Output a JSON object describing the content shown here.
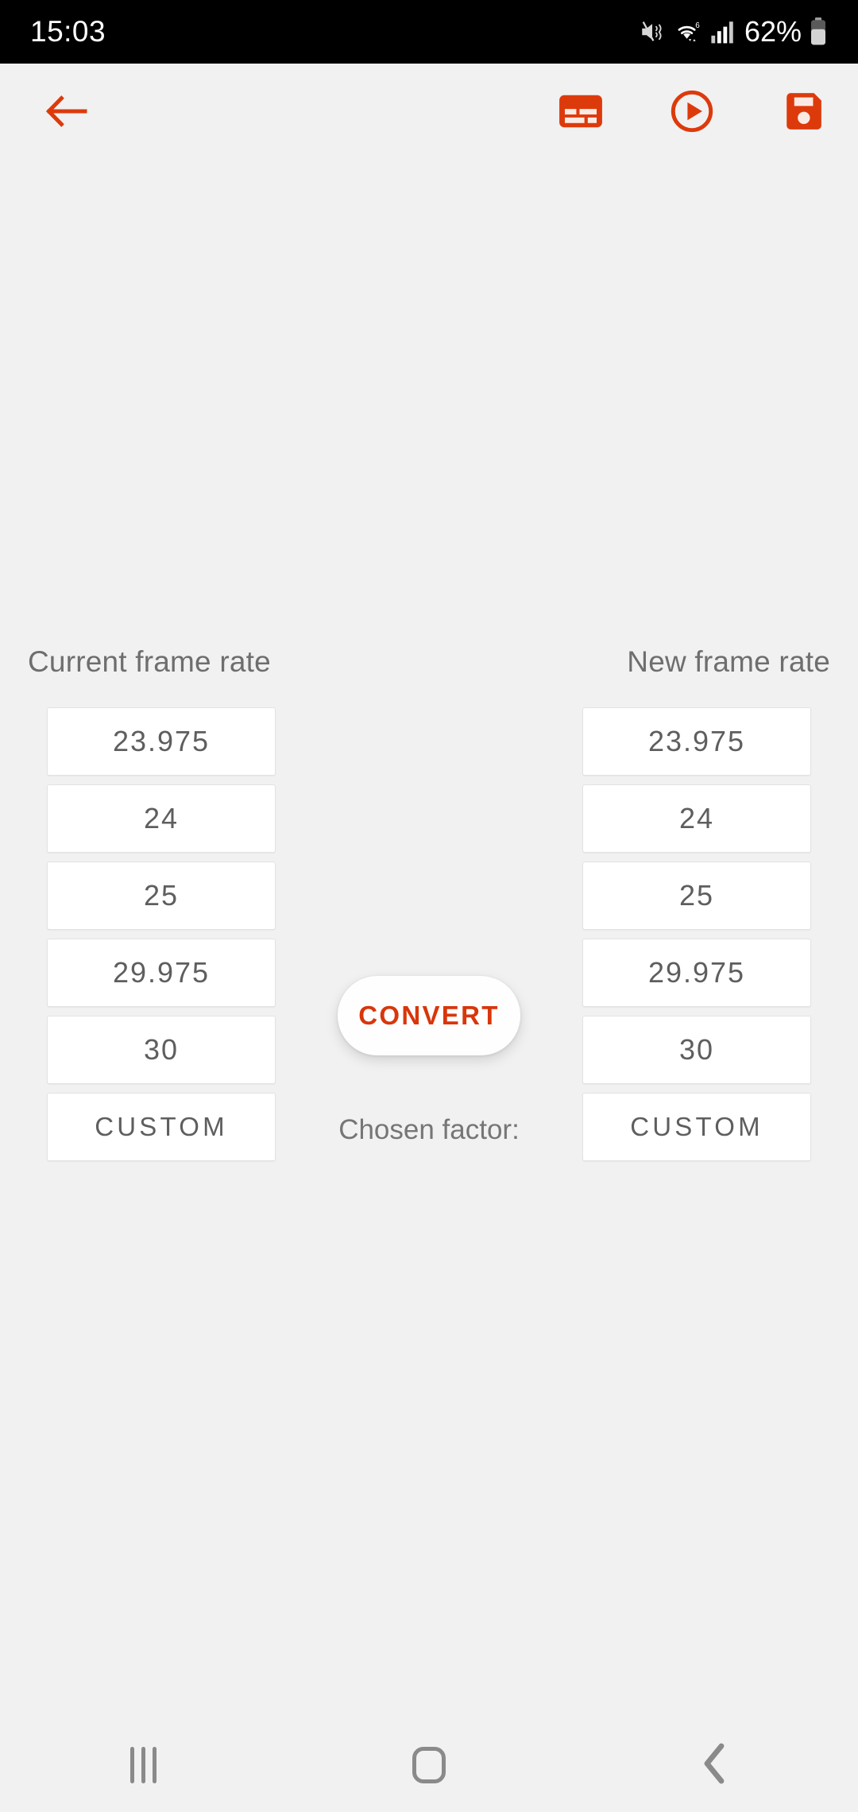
{
  "statusbar": {
    "time": "15:03",
    "battery_percent": "62%",
    "icons": [
      "mute-icon",
      "wifi-icon",
      "signal-icon",
      "battery-icon"
    ]
  },
  "toolbar": {
    "back_label": "back-arrow",
    "actions": [
      {
        "name": "subtitle-button",
        "label": "subtitle-icon"
      },
      {
        "name": "play-button",
        "label": "play-circle-icon"
      },
      {
        "name": "save-button",
        "label": "save-icon"
      }
    ],
    "accent_color": "#dd3a0c"
  },
  "main": {
    "current_header": "Current frame rate",
    "new_header": "New frame rate",
    "current_rates": [
      "23.975",
      "24",
      "25",
      "29.975",
      "30",
      "CUSTOM"
    ],
    "new_rates": [
      "23.975",
      "24",
      "25",
      "29.975",
      "30",
      "CUSTOM"
    ],
    "convert_label": "CONVERT",
    "chosen_factor_label": "Chosen factor:"
  },
  "navbar": {
    "recents_label": "recents",
    "home_label": "home",
    "back_label": "back"
  },
  "colors": {
    "accent": "#dd3a0c",
    "background": "#f1f1f1",
    "button_bg": "#ffffff",
    "text": "#5e5e5e",
    "statusbar_bg": "#000000"
  }
}
